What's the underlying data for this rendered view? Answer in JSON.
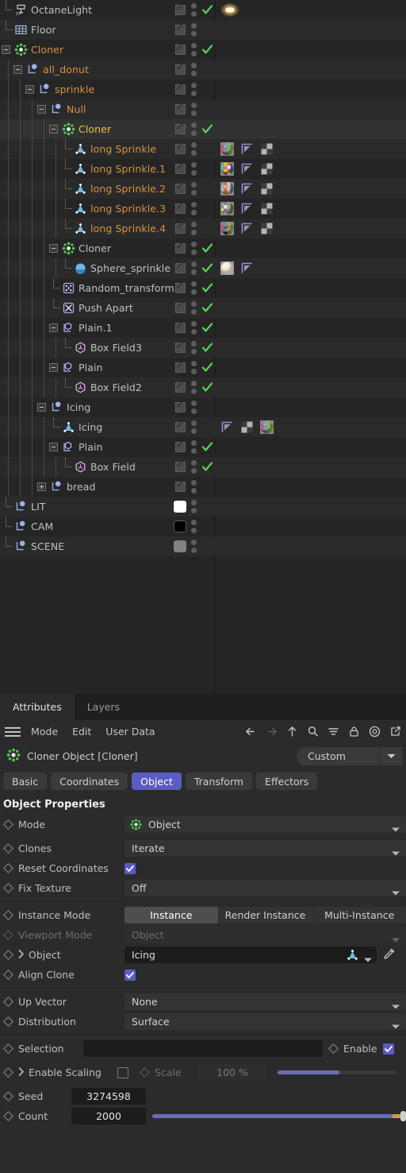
{
  "object_manager": {
    "columns": [
      "enable",
      "visibility",
      "tags"
    ],
    "rows": [
      {
        "label": "OctaneLight",
        "depth": 0,
        "icon": "octane-light-icon",
        "color": "grey",
        "expander": "none",
        "check": true,
        "tags": [
          "light-glow-tag"
        ]
      },
      {
        "label": "Floor",
        "depth": 0,
        "icon": "floor-icon",
        "color": "grey",
        "expander": "none",
        "check": false,
        "tags": []
      },
      {
        "label": "Cloner",
        "depth": 0,
        "icon": "cloner-icon",
        "color": "orange",
        "expander": "minus",
        "check": true,
        "tags": []
      },
      {
        "label": "all_donut",
        "depth": 1,
        "icon": "null-object-icon",
        "color": "orange",
        "expander": "minus",
        "check": false,
        "tags": []
      },
      {
        "label": "sprinkle",
        "depth": 2,
        "icon": "null-object-icon",
        "color": "orange",
        "expander": "minus",
        "check": false,
        "tags": []
      },
      {
        "label": "Null",
        "depth": 3,
        "icon": "null-object-icon",
        "color": "orange",
        "expander": "minus",
        "check": false,
        "tags": []
      },
      {
        "label": "Cloner",
        "depth": 4,
        "icon": "cloner-icon",
        "color": "gold",
        "expander": "minus",
        "check": true,
        "selected": true,
        "tags": []
      },
      {
        "label": "long Sprinkle",
        "depth": 5,
        "icon": "polygon-object-icon",
        "color": "orange",
        "expander": "none",
        "check": false,
        "tags": [
          "material-tag",
          "uvw-tag",
          "selection-tag"
        ]
      },
      {
        "label": "long Sprinkle.1",
        "depth": 5,
        "icon": "polygon-object-icon",
        "color": "orange",
        "expander": "none",
        "check": false,
        "tags": [
          "material-tag",
          "uvw-tag",
          "selection-tag"
        ]
      },
      {
        "label": "long Sprinkle.2",
        "depth": 5,
        "icon": "polygon-object-icon",
        "color": "orange",
        "expander": "none",
        "check": false,
        "tags": [
          "material-tag",
          "uvw-tag",
          "selection-tag"
        ]
      },
      {
        "label": "long Sprinkle.3",
        "depth": 5,
        "icon": "polygon-object-icon",
        "color": "orange",
        "expander": "none",
        "check": false,
        "tags": [
          "material-tag",
          "uvw-tag",
          "selection-tag"
        ]
      },
      {
        "label": "long Sprinkle.4",
        "depth": 5,
        "icon": "polygon-object-icon",
        "color": "orange",
        "expander": "none",
        "check": false,
        "tags": [
          "material-tag",
          "uvw-tag",
          "selection-tag"
        ]
      },
      {
        "label": "Cloner",
        "depth": 4,
        "icon": "cloner-icon",
        "color": "grey",
        "expander": "minus",
        "check": true,
        "tags": []
      },
      {
        "label": "Sphere_sprinkle",
        "depth": 5,
        "icon": "sphere-icon",
        "color": "grey",
        "expander": "none",
        "check": true,
        "tags": [
          "material-tag-cream",
          "uvw-tag"
        ]
      },
      {
        "label": "Random_transform",
        "depth": 4,
        "icon": "random-effector-icon",
        "color": "grey",
        "expander": "none",
        "check": true,
        "tags": []
      },
      {
        "label": "Push Apart",
        "depth": 4,
        "icon": "push-apart-effector-icon",
        "color": "grey",
        "expander": "none",
        "check": true,
        "tags": []
      },
      {
        "label": "Plain.1",
        "depth": 4,
        "icon": "plain-effector-icon",
        "color": "grey",
        "expander": "minus",
        "check": true,
        "tags": []
      },
      {
        "label": "Box Field3",
        "depth": 5,
        "icon": "box-field-icon",
        "color": "grey",
        "expander": "none",
        "check": true,
        "tags": []
      },
      {
        "label": "Plain",
        "depth": 4,
        "icon": "plain-effector-icon",
        "color": "grey",
        "expander": "minus",
        "check": true,
        "tags": []
      },
      {
        "label": "Box Field2",
        "depth": 5,
        "icon": "box-field-icon",
        "color": "grey",
        "expander": "none",
        "check": true,
        "tags": []
      },
      {
        "label": "Icing",
        "depth": 3,
        "icon": "null-object-icon",
        "color": "grey",
        "expander": "minus",
        "check": false,
        "tags": []
      },
      {
        "label": "Icing",
        "depth": 4,
        "icon": "polygon-object-icon",
        "color": "grey",
        "expander": "none",
        "check": false,
        "tags": [
          "uvw-tag",
          "selection-tag",
          "material-tag"
        ]
      },
      {
        "label": "Plain",
        "depth": 4,
        "icon": "plain-effector-icon",
        "color": "grey",
        "expander": "minus",
        "check": true,
        "tags": []
      },
      {
        "label": "Box Field",
        "depth": 5,
        "icon": "box-field-icon",
        "color": "grey",
        "expander": "none",
        "check": true,
        "tags": []
      },
      {
        "label": "bread",
        "depth": 3,
        "icon": "null-object-icon",
        "color": "grey",
        "expander": "plus",
        "check": false,
        "tags": []
      },
      {
        "label": "LIT",
        "depth": 0,
        "icon": "null-object-icon",
        "color": "grey",
        "expander": "none",
        "layer_color": "#ffffff",
        "tags": []
      },
      {
        "label": "CAM",
        "depth": 0,
        "icon": "null-object-icon",
        "color": "grey",
        "expander": "none",
        "layer_color": "#000000",
        "tags": []
      },
      {
        "label": "SCENE",
        "depth": 0,
        "icon": "null-object-icon",
        "color": "grey",
        "expander": "none",
        "layer_color": "#828282",
        "tags": []
      }
    ]
  },
  "attributes": {
    "panel_tabs": [
      {
        "label": "Attributes",
        "active": true
      },
      {
        "label": "Layers",
        "active": false
      }
    ],
    "menu": [
      "Mode",
      "Edit",
      "User Data"
    ],
    "toolbar_icons": [
      "back-arrow-icon",
      "forward-arrow-icon",
      "up-arrow-icon",
      "search-icon",
      "filter-icon",
      "lock-icon",
      "target-icon",
      "open-external-icon"
    ],
    "object_title": "Cloner Object [Cloner]",
    "object_icon": "cloner-icon",
    "preset": {
      "value": "Custom"
    },
    "sub_tabs": [
      {
        "label": "Basic",
        "active": false
      },
      {
        "label": "Coordinates",
        "active": false
      },
      {
        "label": "Object",
        "active": true
      },
      {
        "label": "Transform",
        "active": false
      },
      {
        "label": "Effectors",
        "active": false
      }
    ],
    "section_title": "Object Properties",
    "properties": {
      "mode": {
        "label": "Mode",
        "value": "Object",
        "icon": "cloner-icon"
      },
      "clones": {
        "label": "Clones",
        "value": "Iterate"
      },
      "reset_coordinates": {
        "label": "Reset Coordinates",
        "checked": true
      },
      "fix_texture": {
        "label": "Fix Texture",
        "value": "Off"
      },
      "instance_mode": {
        "label": "Instance Mode",
        "options": [
          "Instance",
          "Render Instance",
          "Multi-Instance"
        ],
        "selected": "Instance"
      },
      "viewport_mode": {
        "label": "Viewport Mode",
        "value": "Object",
        "disabled": true
      },
      "object": {
        "label": "Object",
        "value": "Icing",
        "icon": "polygon-object-icon",
        "picker": "eyedropper-icon"
      },
      "align_clone": {
        "label": "Align Clone",
        "checked": true
      },
      "up_vector": {
        "label": "Up Vector",
        "value": "None"
      },
      "distribution": {
        "label": "Distribution",
        "value": "Surface"
      },
      "selection": {
        "label": "Selection",
        "value": "",
        "enable_label": "Enable",
        "enabled": true
      },
      "enable_scaling": {
        "label": "Enable Scaling",
        "checked": false
      },
      "scale": {
        "label": "Scale",
        "value": "100 %",
        "percent": 100,
        "disabled": true
      },
      "seed": {
        "label": "Seed",
        "value": "3274598"
      },
      "count": {
        "label": "Count",
        "value": "2000",
        "slider_percent": 100
      }
    }
  },
  "colors": {
    "accent_purple": "#5b5bc4",
    "object_orange": "#d8913f",
    "selected_gold": "#f2c33c",
    "check_green": "#55d45a",
    "slider_fill": "#6c6cb4",
    "slider_tail": "#d79a43",
    "panel_bg": "#2b2b2b",
    "tree_bg": "#252525"
  }
}
